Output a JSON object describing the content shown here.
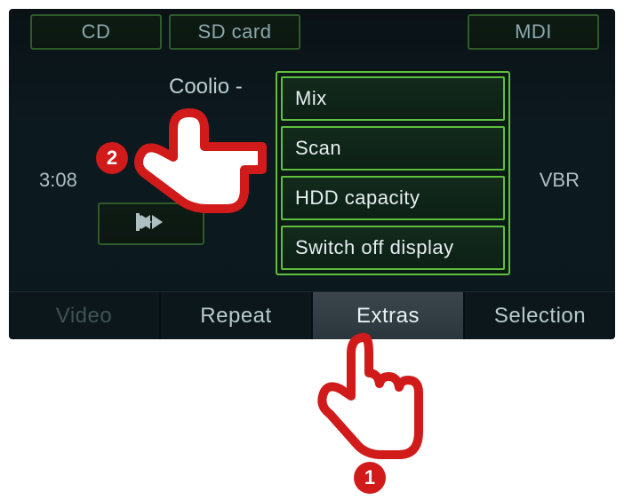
{
  "top_tabs": {
    "cd": "CD",
    "sd": "SD card",
    "mdi": "MDI"
  },
  "now_playing": {
    "artist_line": "Coolio -",
    "elapsed": "3:08",
    "bitrate_mode": "VBR"
  },
  "bottom_tabs": {
    "video": "Video",
    "repeat": "Repeat",
    "extras": "Extras",
    "selection": "Selection"
  },
  "extras_menu": {
    "mix": "Mix",
    "scan": "Scan",
    "hdd": "HDD capacity",
    "switch_off": "Switch off display"
  },
  "annotations": {
    "step1": "1",
    "step2": "2"
  }
}
